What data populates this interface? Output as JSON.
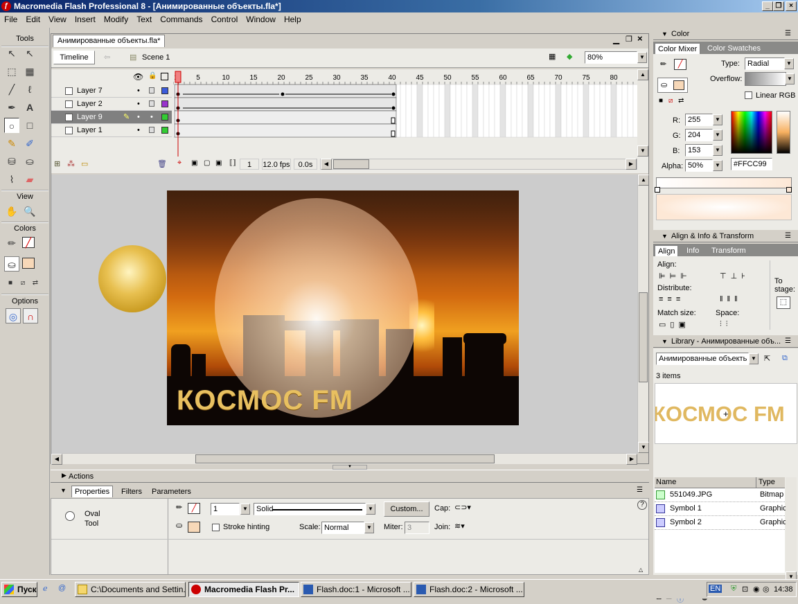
{
  "window": {
    "title": "Macromedia Flash Professional 8 - [Анимированные объекты.fla*]"
  },
  "menu": [
    "File",
    "Edit",
    "View",
    "Insert",
    "Modify",
    "Text",
    "Commands",
    "Control",
    "Window",
    "Help"
  ],
  "tools": {
    "title": "Tools",
    "view_label": "View",
    "colors_label": "Colors",
    "options_label": "Options"
  },
  "document": {
    "tab": "Анимированные объекты.fla*",
    "timeline_button": "Timeline",
    "scene": "Scene 1",
    "zoom": "80%"
  },
  "timeline": {
    "frame_numbers": [
      "1",
      "5",
      "10",
      "15",
      "20",
      "25",
      "30",
      "35",
      "40",
      "45",
      "50",
      "55",
      "60",
      "65",
      "70",
      "75",
      "80"
    ],
    "layers": [
      {
        "name": "Layer 7",
        "color": "#3b5bdb",
        "active": false
      },
      {
        "name": "Layer 2",
        "color": "#9933cc",
        "active": false
      },
      {
        "name": "Layer 9",
        "color": "#33cc33",
        "active": true
      },
      {
        "name": "Layer 1",
        "color": "#33cc33",
        "active": false
      }
    ],
    "current_frame": "1",
    "fps": "12.0 fps",
    "time": "0.0s"
  },
  "stage": {
    "text": "КОСМОС FM"
  },
  "panels": {
    "actions": "Actions",
    "properties_tabs": [
      "Properties",
      "Filters",
      "Parameters"
    ],
    "tool_name": "Oval",
    "tool_name2": "Tool",
    "stroke_height": "1",
    "stroke_style": "Solid",
    "custom_button": "Custom...",
    "cap_label": "Cap:",
    "stroke_hinting_label": "Stroke hinting",
    "scale_label": "Scale:",
    "scale_value": "Normal",
    "miter_label": "Miter:",
    "miter_value": "3",
    "join_label": "Join:"
  },
  "color": {
    "panel_title": "Color",
    "tabs": [
      "Color Mixer",
      "Color Swatches"
    ],
    "type_label": "Type:",
    "type_value": "Radial",
    "overflow_label": "Overflow:",
    "linear_rgb": "Linear RGB",
    "r_label": "R:",
    "r": "255",
    "g_label": "G:",
    "g": "204",
    "b_label": "B:",
    "b": "153",
    "alpha_label": "Alpha:",
    "alpha": "50%",
    "hex": "#FFCC99"
  },
  "align": {
    "panel_title": "Align & Info & Transform",
    "tabs": [
      "Align",
      "Info",
      "Transform"
    ],
    "align_label": "Align:",
    "distribute_label": "Distribute:",
    "match_label": "Match size:",
    "space_label": "Space:",
    "to_stage": "To",
    "to_stage2": "stage:"
  },
  "library": {
    "panel_title": "Library - Анимированные объ...",
    "doc_select": "Анимированные объекть",
    "count": "3 items",
    "preview_text": "КОСМОС FM",
    "col_name": "Name",
    "col_type": "Type",
    "items": [
      {
        "name": "551049.JPG",
        "type": "Bitmap"
      },
      {
        "name": "Symbol 1",
        "type": "Graphic"
      },
      {
        "name": "Symbol 2",
        "type": "Graphic"
      }
    ]
  },
  "taskbar": {
    "start": "Пуск",
    "tasks": [
      {
        "label": "C:\\Documents and Settin...",
        "active": false
      },
      {
        "label": "Macromedia Flash Pr...",
        "active": true
      },
      {
        "label": "Flash.doc:1 - Microsoft ...",
        "active": false
      },
      {
        "label": "Flash.doc:2 - Microsoft ...",
        "active": false
      }
    ],
    "lang": "EN",
    "clock": "14:38"
  }
}
